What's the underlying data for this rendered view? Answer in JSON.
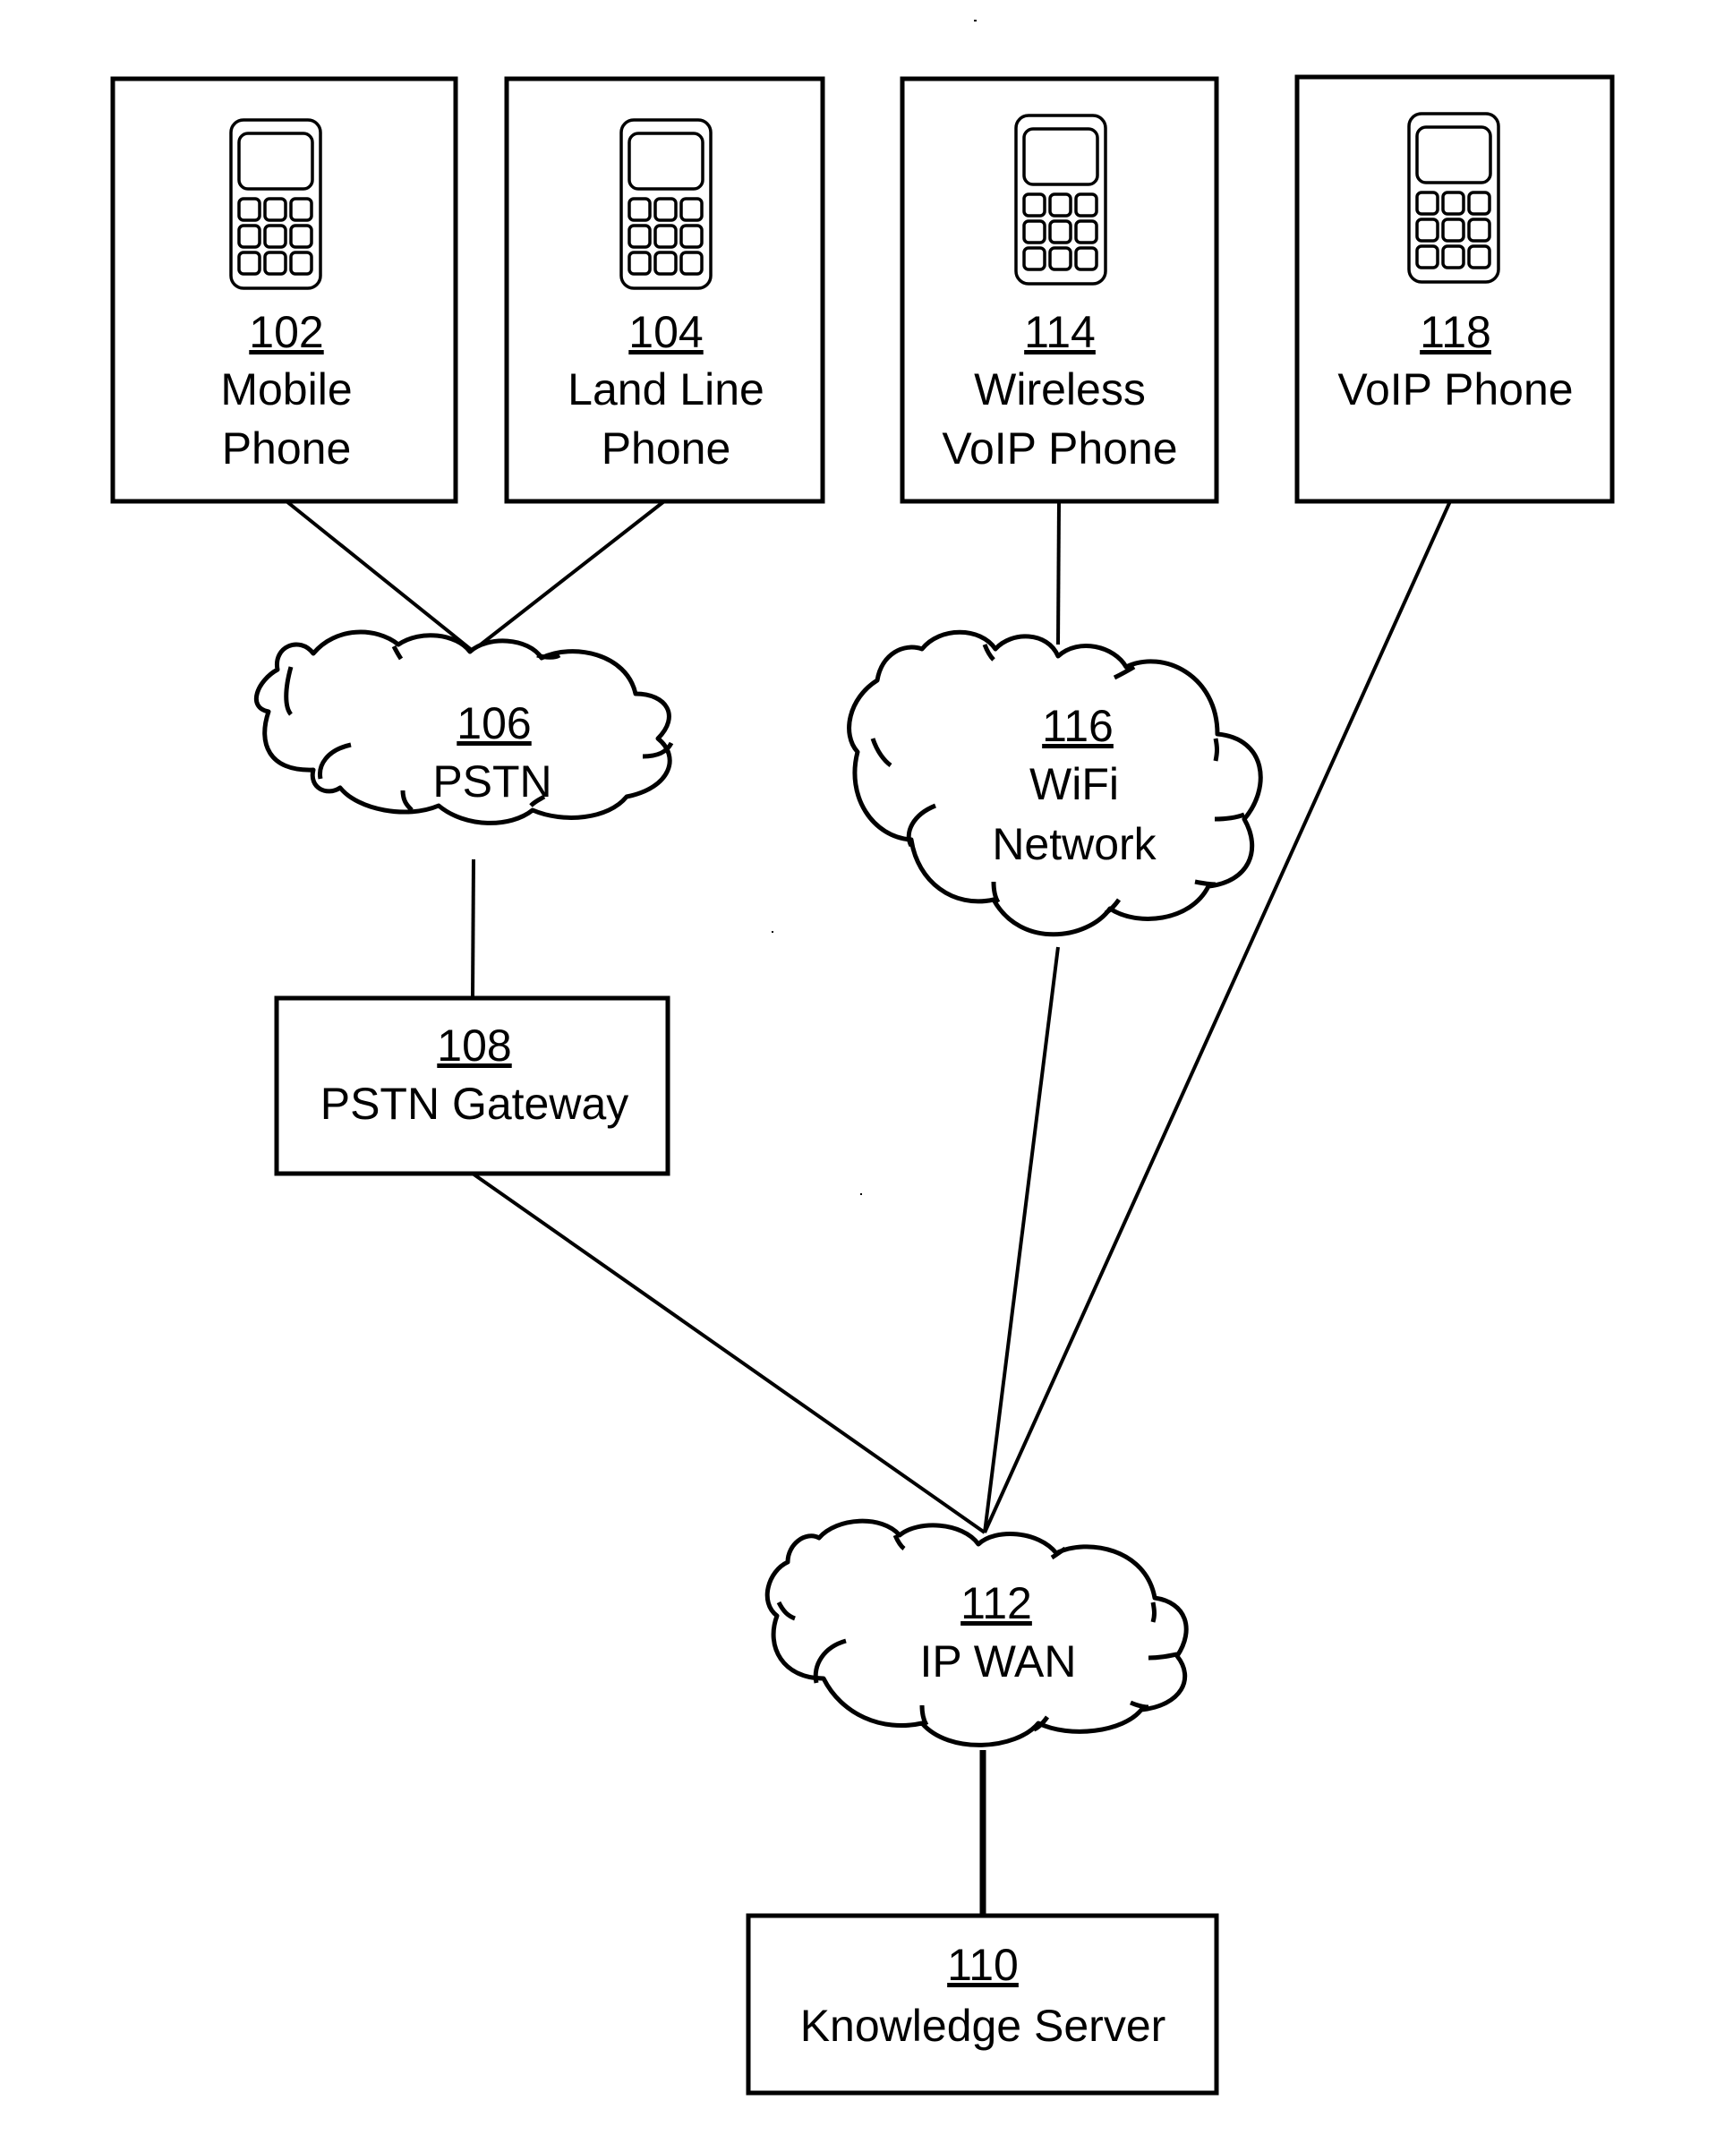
{
  "figure": {
    "type": "network-diagram",
    "colors": {
      "ink": "#000000",
      "paper": "#ffffff"
    }
  },
  "nodes": {
    "mobile_phone": {
      "ref": "102",
      "lines": [
        "Mobile",
        "Phone"
      ],
      "shape": "box",
      "icon": "mobile-phone-icon"
    },
    "land_line_phone": {
      "ref": "104",
      "lines": [
        "Land Line",
        "Phone"
      ],
      "shape": "box",
      "icon": "mobile-phone-icon"
    },
    "wireless_voip": {
      "ref": "114",
      "lines": [
        "Wireless",
        "VoIP Phone"
      ],
      "shape": "box",
      "icon": "mobile-phone-icon"
    },
    "voip_phone": {
      "ref": "118",
      "lines": [
        "VoIP Phone"
      ],
      "shape": "box",
      "icon": "mobile-phone-icon"
    },
    "pstn": {
      "ref": "106",
      "lines": [
        "PSTN"
      ],
      "shape": "cloud"
    },
    "wifi_network": {
      "ref": "116",
      "lines": [
        "WiFi",
        "Network"
      ],
      "shape": "cloud"
    },
    "pstn_gateway": {
      "ref": "108",
      "lines": [
        "PSTN Gateway"
      ],
      "shape": "box"
    },
    "ip_wan": {
      "ref": "112",
      "lines": [
        "IP WAN"
      ],
      "shape": "cloud"
    },
    "knowledge_server": {
      "ref": "110",
      "lines": [
        "Knowledge Server"
      ],
      "shape": "box"
    }
  },
  "connections": [
    {
      "from": "102",
      "to": "106"
    },
    {
      "from": "104",
      "to": "106"
    },
    {
      "from": "106",
      "to": "108"
    },
    {
      "from": "108",
      "to": "112"
    },
    {
      "from": "114",
      "to": "116"
    },
    {
      "from": "116",
      "to": "112"
    },
    {
      "from": "118",
      "to": "112"
    },
    {
      "from": "112",
      "to": "110"
    }
  ]
}
